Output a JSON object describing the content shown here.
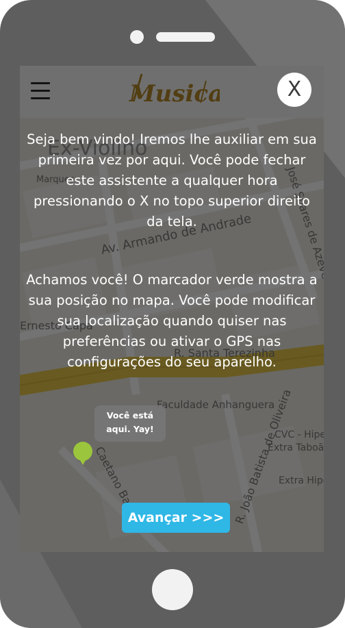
{
  "app": {
    "logo_text": "Musicar"
  },
  "header": {
    "close_label": "X"
  },
  "map": {
    "streets": [
      "Ex-Violino",
      "Marques",
      "Av. Armando de Andrade",
      "Ernesto Capa",
      "José Soares de Azevedo",
      "R. Santa Terezinha",
      "Faculdade Anhanguera",
      "Caetano Barre",
      "R. João Batista de Oliveira",
      "CVC - Hipe",
      "Extra Taboão",
      "Extra Hipe"
    ]
  },
  "assistant": {
    "intro_text": "Seja bem vindo! Iremos lhe auxiliar em sua primeira vez por aqui. Você pode fechar este assistente a qualquer hora pressionando o X no topo superior direito da tela.",
    "gps_text": "Achamos você! O marcador verde mostra a sua posição no mapa. Você pode modificar sua localização quando quiser nas preferências ou ativar o GPS nas configurações do seu aparelho.",
    "pin_tooltip": "Você está aqui. Yay!",
    "next_label": "Avançar >>>"
  },
  "colors": {
    "accent": "#2fb7e6",
    "pin": "#9bc53d",
    "logo": "#b58a2a",
    "phone": "#5e5e5e"
  }
}
